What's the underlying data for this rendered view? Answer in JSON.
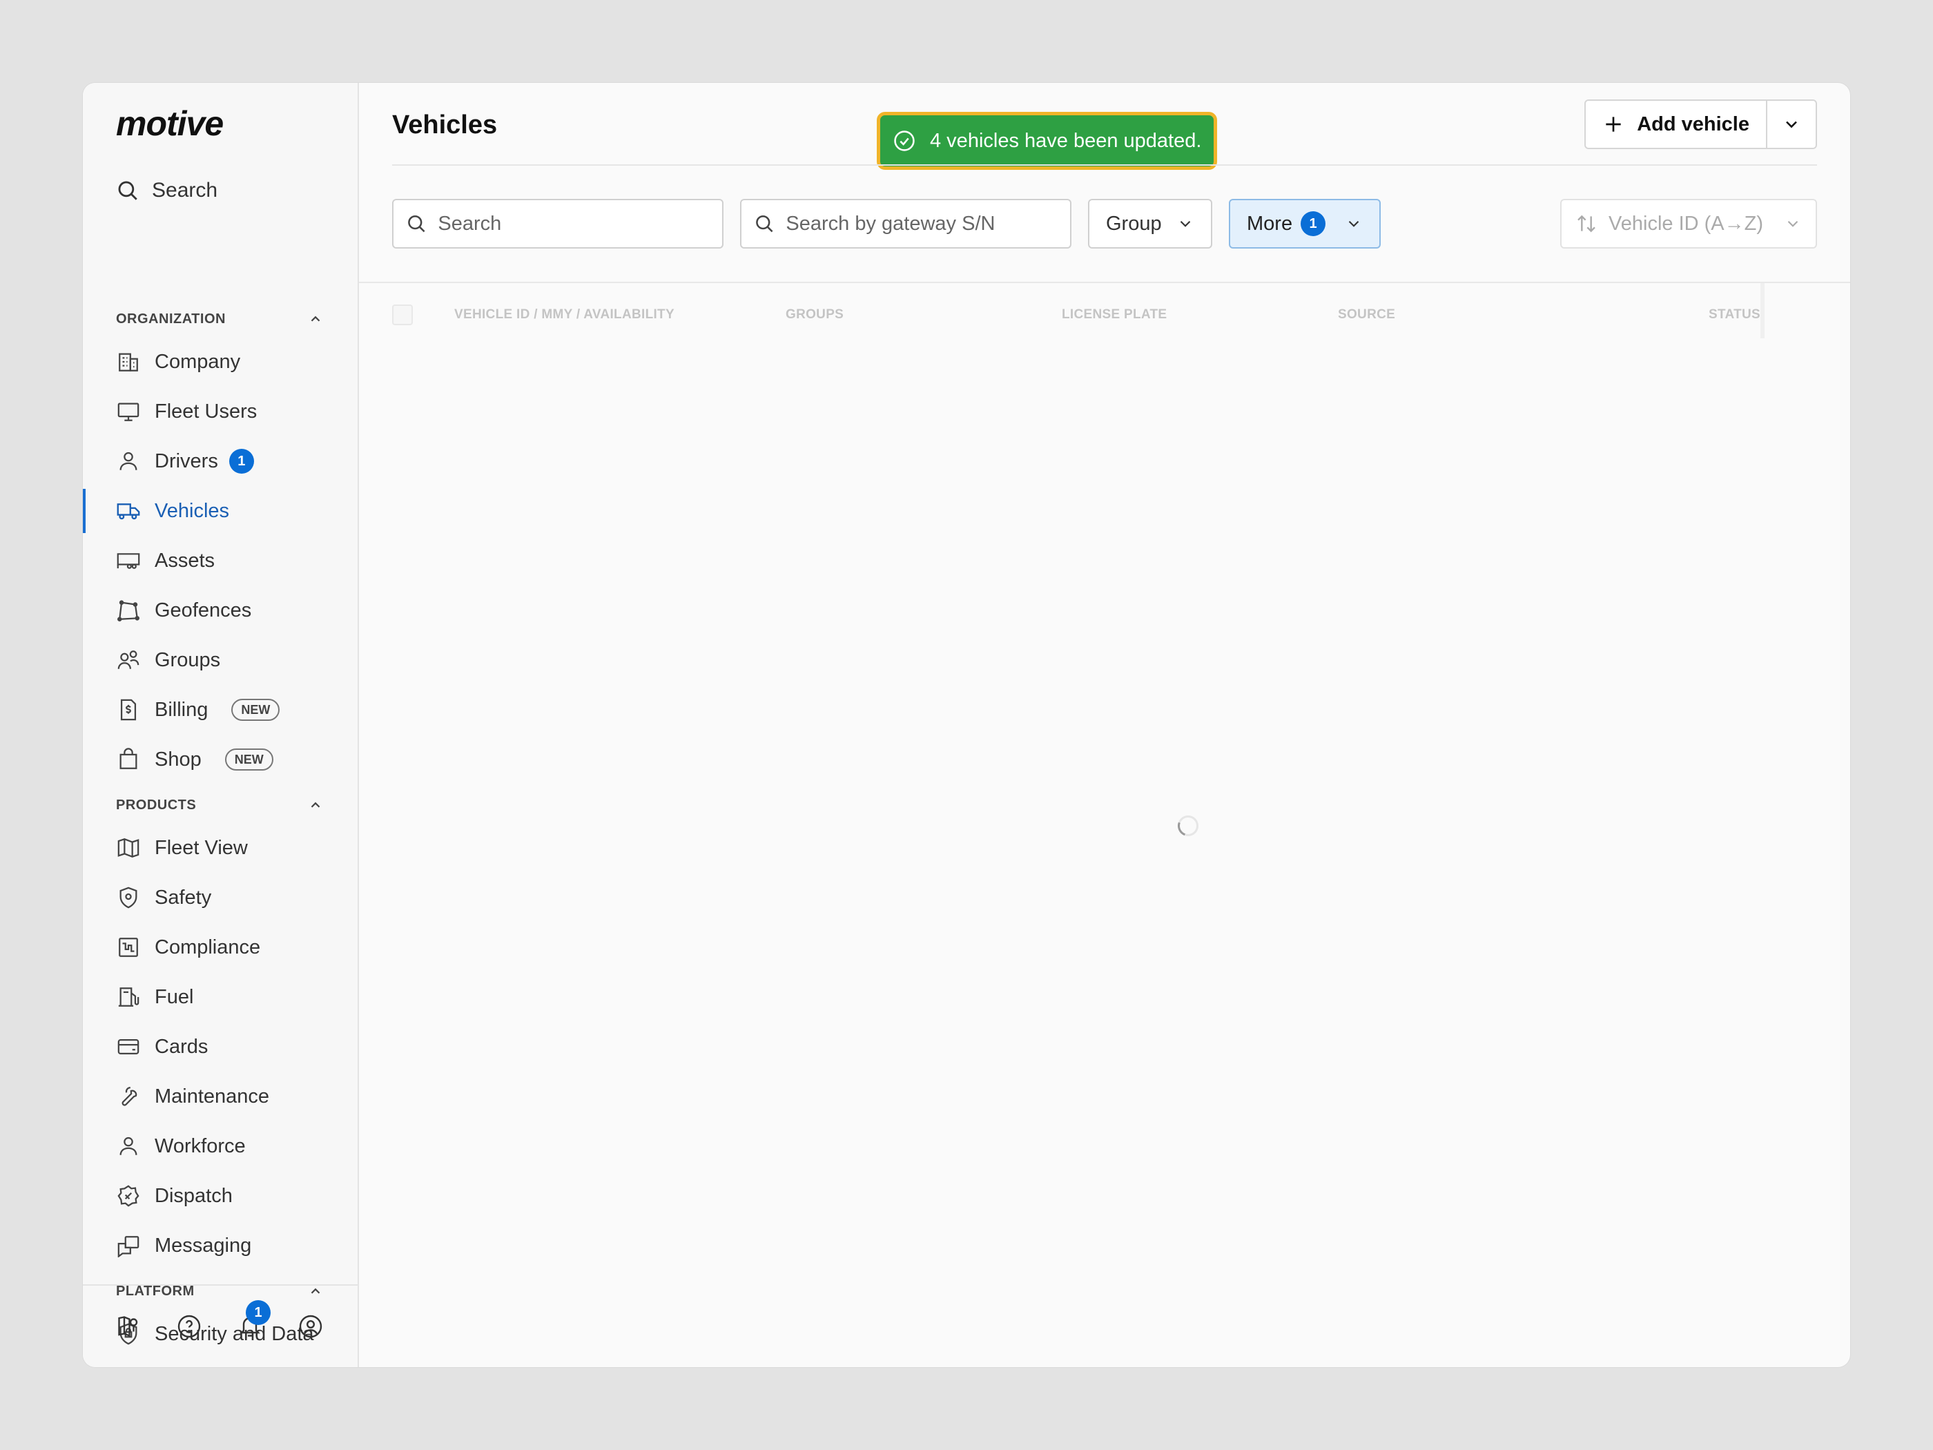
{
  "app": {
    "brand": "motive"
  },
  "sidebar": {
    "search_label": "Search",
    "sections": {
      "organization": "ORGANIZATION",
      "products": "PRODUCTS",
      "platform": "PLATFORM"
    },
    "items": {
      "company": "Company",
      "fleet_users": "Fleet Users",
      "drivers": "Drivers",
      "drivers_badge": "1",
      "vehicles": "Vehicles",
      "assets": "Assets",
      "geofences": "Geofences",
      "groups": "Groups",
      "billing": "Billing",
      "billing_badge": "NEW",
      "shop": "Shop",
      "shop_badge": "NEW",
      "fleet_view": "Fleet View",
      "safety": "Safety",
      "compliance": "Compliance",
      "fuel": "Fuel",
      "cards": "Cards",
      "maintenance": "Maintenance",
      "workforce": "Workforce",
      "dispatch": "Dispatch",
      "messaging": "Messaging",
      "security_data": "Security and Data"
    },
    "footer": {
      "notifications_count": "1"
    }
  },
  "main": {
    "title": "Vehicles",
    "toast": "4 vehicles have been updated.",
    "add_vehicle_label": "Add vehicle",
    "filters": {
      "search_placeholder": "Search",
      "gateway_placeholder": "Search by gateway S/N",
      "group_label": "Group",
      "more_label": "More",
      "more_count": "1",
      "sort_label": "Vehicle ID (A→Z)"
    },
    "table": {
      "columns": [
        "VEHICLE ID / MMY / AVAILABILITY",
        "GROUPS",
        "LICENSE PLATE",
        "SOURCE",
        "STATUS"
      ]
    }
  },
  "colors": {
    "accent": "#0a6ed6",
    "toast_bg": "#2ea043",
    "toast_border": "#f0b429"
  }
}
